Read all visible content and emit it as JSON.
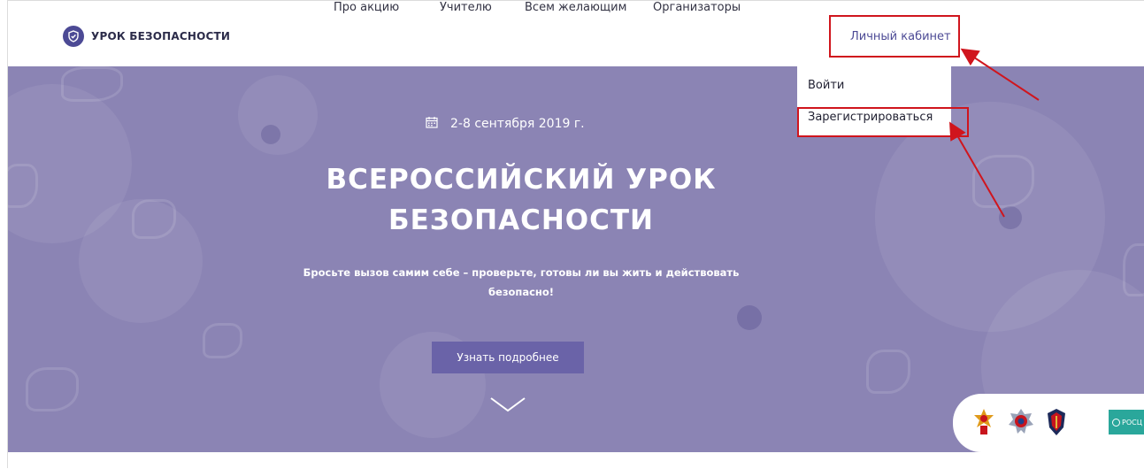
{
  "header": {
    "logo_text": "УРОК БЕЗОПАСНОСТИ",
    "nav": [
      {
        "label": "Про акцию"
      },
      {
        "label": "Учителю"
      },
      {
        "label": "Всем желающим"
      },
      {
        "label": "Организаторы"
      }
    ],
    "cabinet_label": "Личный кабинет"
  },
  "dropdown": {
    "items": [
      {
        "label": "Войти"
      },
      {
        "label": "Зарегистрироваться"
      }
    ]
  },
  "hero": {
    "date": "2-8 сентября 2019 г.",
    "title_line1": "ВСЕРОССИЙСКИЙ УРОК",
    "title_line2": "БЕЗОПАСНОСТИ",
    "subtitle_line1": "Бросьте вызов самим себе – проверьте, готовы ли вы жить и действовать",
    "subtitle_line2": "безопасно!",
    "button_label": "Узнать подробнее"
  },
  "partners": {
    "last_label": "РОСЦ"
  },
  "colors": {
    "accent": "#4c4a95",
    "hero_bg": "#8b84b4",
    "button_bg": "#6a63a8",
    "highlight": "#d0151d"
  },
  "icons": [
    "shield-logo-icon",
    "calendar-icon",
    "chevron-down-icon",
    "emercom-emblem-icon",
    "mvd-emblem-icon",
    "fsb-emblem-icon"
  ]
}
